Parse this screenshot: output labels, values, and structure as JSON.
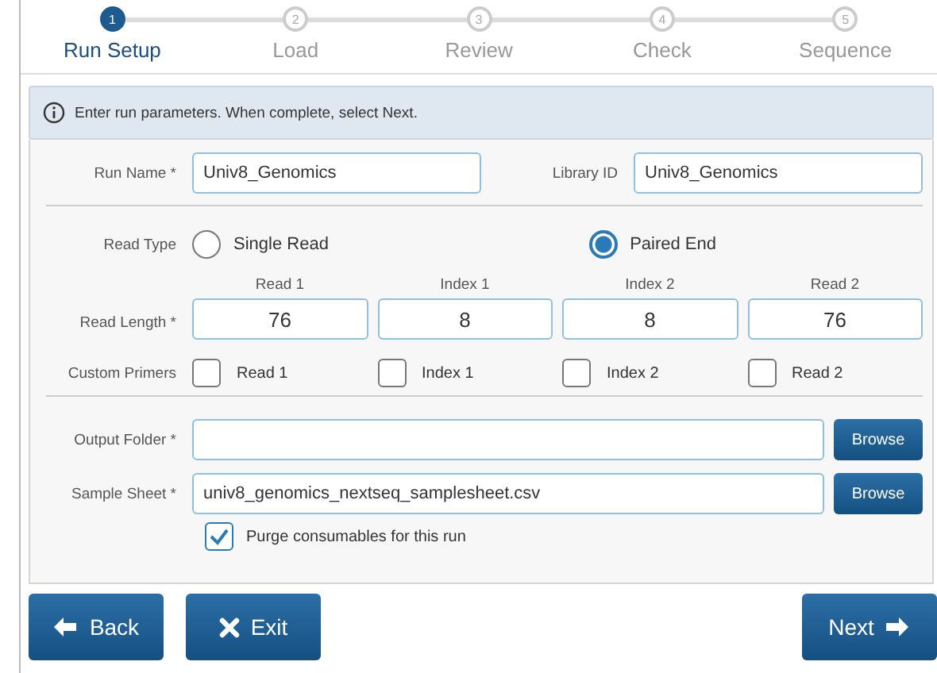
{
  "steps": [
    {
      "number": "1",
      "label": "Run Setup",
      "selected": true
    },
    {
      "number": "2",
      "label": "Load",
      "selected": false
    },
    {
      "number": "3",
      "label": "Review",
      "selected": false
    },
    {
      "number": "4",
      "label": "Check",
      "selected": false
    },
    {
      "number": "5",
      "label": "Sequence",
      "selected": false
    }
  ],
  "info": "Enter run parameters. When complete, select Next.",
  "run_name": {
    "label": "Run Name *",
    "value": "Univ8_Genomics"
  },
  "library_id": {
    "label": "Library ID",
    "value": "Univ8_Genomics"
  },
  "read_type": {
    "label": "Read Type",
    "options": [
      {
        "label": "Single Read",
        "selected": false
      },
      {
        "label": "Paired End",
        "selected": true
      }
    ]
  },
  "read_length": {
    "label": "Read Length *",
    "fields": [
      {
        "label": "Read 1",
        "value": "76"
      },
      {
        "label": "Index 1",
        "value": "8"
      },
      {
        "label": "Index 2",
        "value": "8"
      },
      {
        "label": "Read 2",
        "value": "76"
      }
    ]
  },
  "custom_primers": {
    "label": "Custom Primers",
    "options": [
      {
        "label": "Read 1",
        "checked": false
      },
      {
        "label": "Index 1",
        "checked": false
      },
      {
        "label": "Index 2",
        "checked": false
      },
      {
        "label": "Read 2",
        "checked": false
      }
    ]
  },
  "output_folder": {
    "label": "Output Folder *",
    "button": "Browse"
  },
  "sample_sheet": {
    "label": "Sample Sheet *",
    "value": "univ8_genomics_nextseq_samplesheet.csv",
    "button": "Browse"
  },
  "purge": {
    "label": "Purge consumables for this run",
    "checked": true
  },
  "buttons": [
    {
      "kind": "back",
      "label": "Back"
    },
    {
      "kind": "exit",
      "label": "Exit"
    },
    {
      "kind": "next",
      "label": "Next"
    }
  ]
}
